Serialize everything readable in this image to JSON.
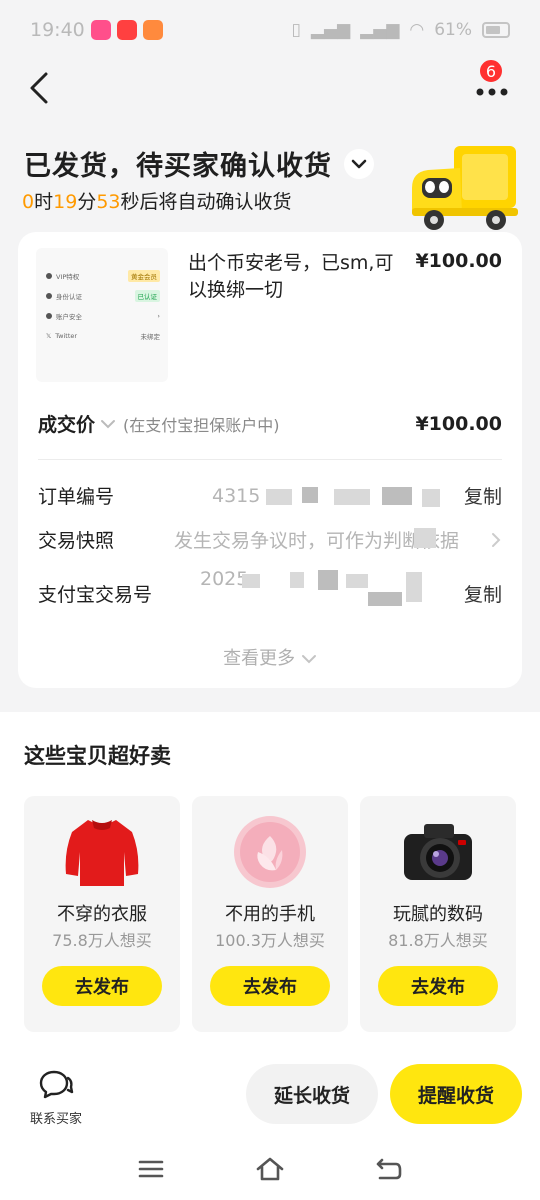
{
  "status_bar": {
    "time": "19:40",
    "battery": "61%",
    "network": "4G"
  },
  "header": {
    "notification_count": "6",
    "title": "已发货，待买家确认收货",
    "countdown": {
      "hours": "0",
      "hours_unit": "时",
      "minutes": "19",
      "minutes_unit": "分",
      "seconds": "53",
      "seconds_suffix": "秒后将自动确认收货"
    }
  },
  "order": {
    "thumbnail_rows": [
      {
        "label": "VIP特权",
        "tag": "黄金会员"
      },
      {
        "label": "身份认证",
        "tag": "已认证"
      },
      {
        "label": "账户安全",
        "tag": ""
      },
      {
        "label": "Twitter",
        "tag": "未绑定"
      }
    ],
    "product_title": "出个币安老号，已sm,可以换绑一切",
    "product_price": "¥100.00",
    "deal_label": "成交价",
    "deal_note": "(在支付宝担保账户中)",
    "deal_price": "¥100.00",
    "rows": [
      {
        "label": "订单编号",
        "value": "4315",
        "action": "复制"
      },
      {
        "label": "交易快照",
        "value": "发生交易争议时，可作为判断依据",
        "action": ""
      },
      {
        "label": "支付宝交易号",
        "value": "2025",
        "action": "复制"
      }
    ],
    "see_more": "查看更多"
  },
  "recommend": {
    "title": "这些宝贝超好卖",
    "items": [
      {
        "name": "不穿的衣服",
        "wants": "75.8万人想买",
        "button": "去发布",
        "icon": "red-sweater-icon"
      },
      {
        "name": "不用的手机",
        "wants": "100.3万人想买",
        "button": "去发布",
        "icon": "pink-phone-icon"
      },
      {
        "name": "玩腻的数码",
        "wants": "81.8万人想买",
        "button": "去发布",
        "icon": "camera-icon"
      }
    ]
  },
  "actions": {
    "contact": "联系买家",
    "extend": "延长收货",
    "remind": "提醒收货"
  },
  "colors": {
    "accent_yellow": "#ffe60f",
    "countdown_orange": "#ff9a00",
    "badge_red": "#ff3030"
  }
}
